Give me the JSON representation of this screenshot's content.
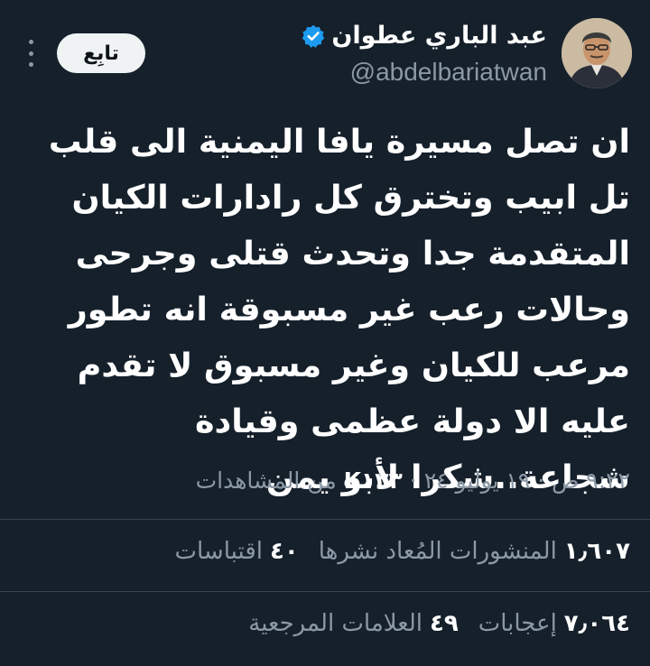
{
  "author": {
    "display_name": "عبد الباري عطوان",
    "handle": "@abdelbariatwan",
    "verified": true,
    "avatar_icon": "person-photo-avatar"
  },
  "follow_button": {
    "label": "تابِع"
  },
  "more_menu_icon": "vertical-dots-icon",
  "tweet": {
    "text": "ان تصل مسيرة يافا اليمنية الى قلب تل ابيب وتخترق كل رادارات الكيان المتقدمة جدا وتحدث قتلى وجرحى وحالات رعب غير مسبوقة انه تطور مرعب للكيان وغير مسبوق لا تقدم عليه الا دولة عظمى وقيادة شجاعة..شكرا لأبو يمن"
  },
  "meta": {
    "time": "٩:٢٢ ص",
    "date": "١٩ يوليو ٢٤",
    "views_count": "K١٢٣",
    "views_label": "من المشاهدات",
    "separator": "·"
  },
  "stats_row_1": [
    {
      "count": "١٫٦٠٧",
      "label": "المنشورات المُعاد نشرها"
    },
    {
      "count": "٤٠",
      "label": "اقتباسات"
    }
  ],
  "stats_row_2": [
    {
      "count": "٧٫٠٦٤",
      "label": "إعجابات"
    },
    {
      "count": "٤٩",
      "label": "العلامات المرجعية"
    }
  ],
  "colors": {
    "background": "#15202b",
    "secondary_text": "#8b98a5",
    "verified_blue": "#1d9bf0",
    "divider": "#38444d"
  }
}
